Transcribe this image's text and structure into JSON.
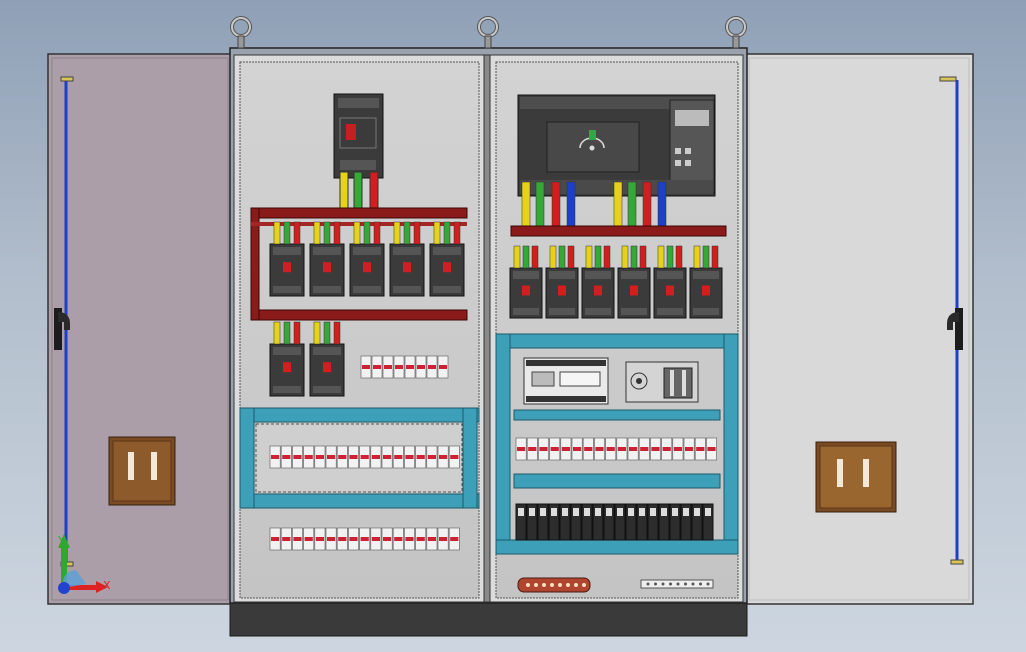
{
  "viewport": {
    "title": ""
  },
  "triad": {
    "x_label": "X",
    "y_label": "Y"
  },
  "colors": {
    "background_top": "#8fa0b6",
    "background_bottom": "#cdd6e0",
    "left_door": "#ab9ea8",
    "right_door": "#d9d9d9",
    "cabinet_plate": "#cfcfcf",
    "busbar": "#8b1a1a",
    "din_rail": "#3d9fb8",
    "plinth": "#3a3a3a",
    "wire_yellow": "#e6d21a",
    "wire_green": "#35a835",
    "wire_red": "#d21e1e",
    "wire_blue": "#1e3fc8",
    "handle_bronze": "#7a4a22",
    "breaker_body": "#3b3b3b"
  },
  "components": {
    "lifting_eyes": 3,
    "left_panel_breakers_row1": 5,
    "left_panel_breakers_row2": 2,
    "right_panel_breakers": 6,
    "terminal_strips_left": 3,
    "terminal_strips_right": 2
  }
}
